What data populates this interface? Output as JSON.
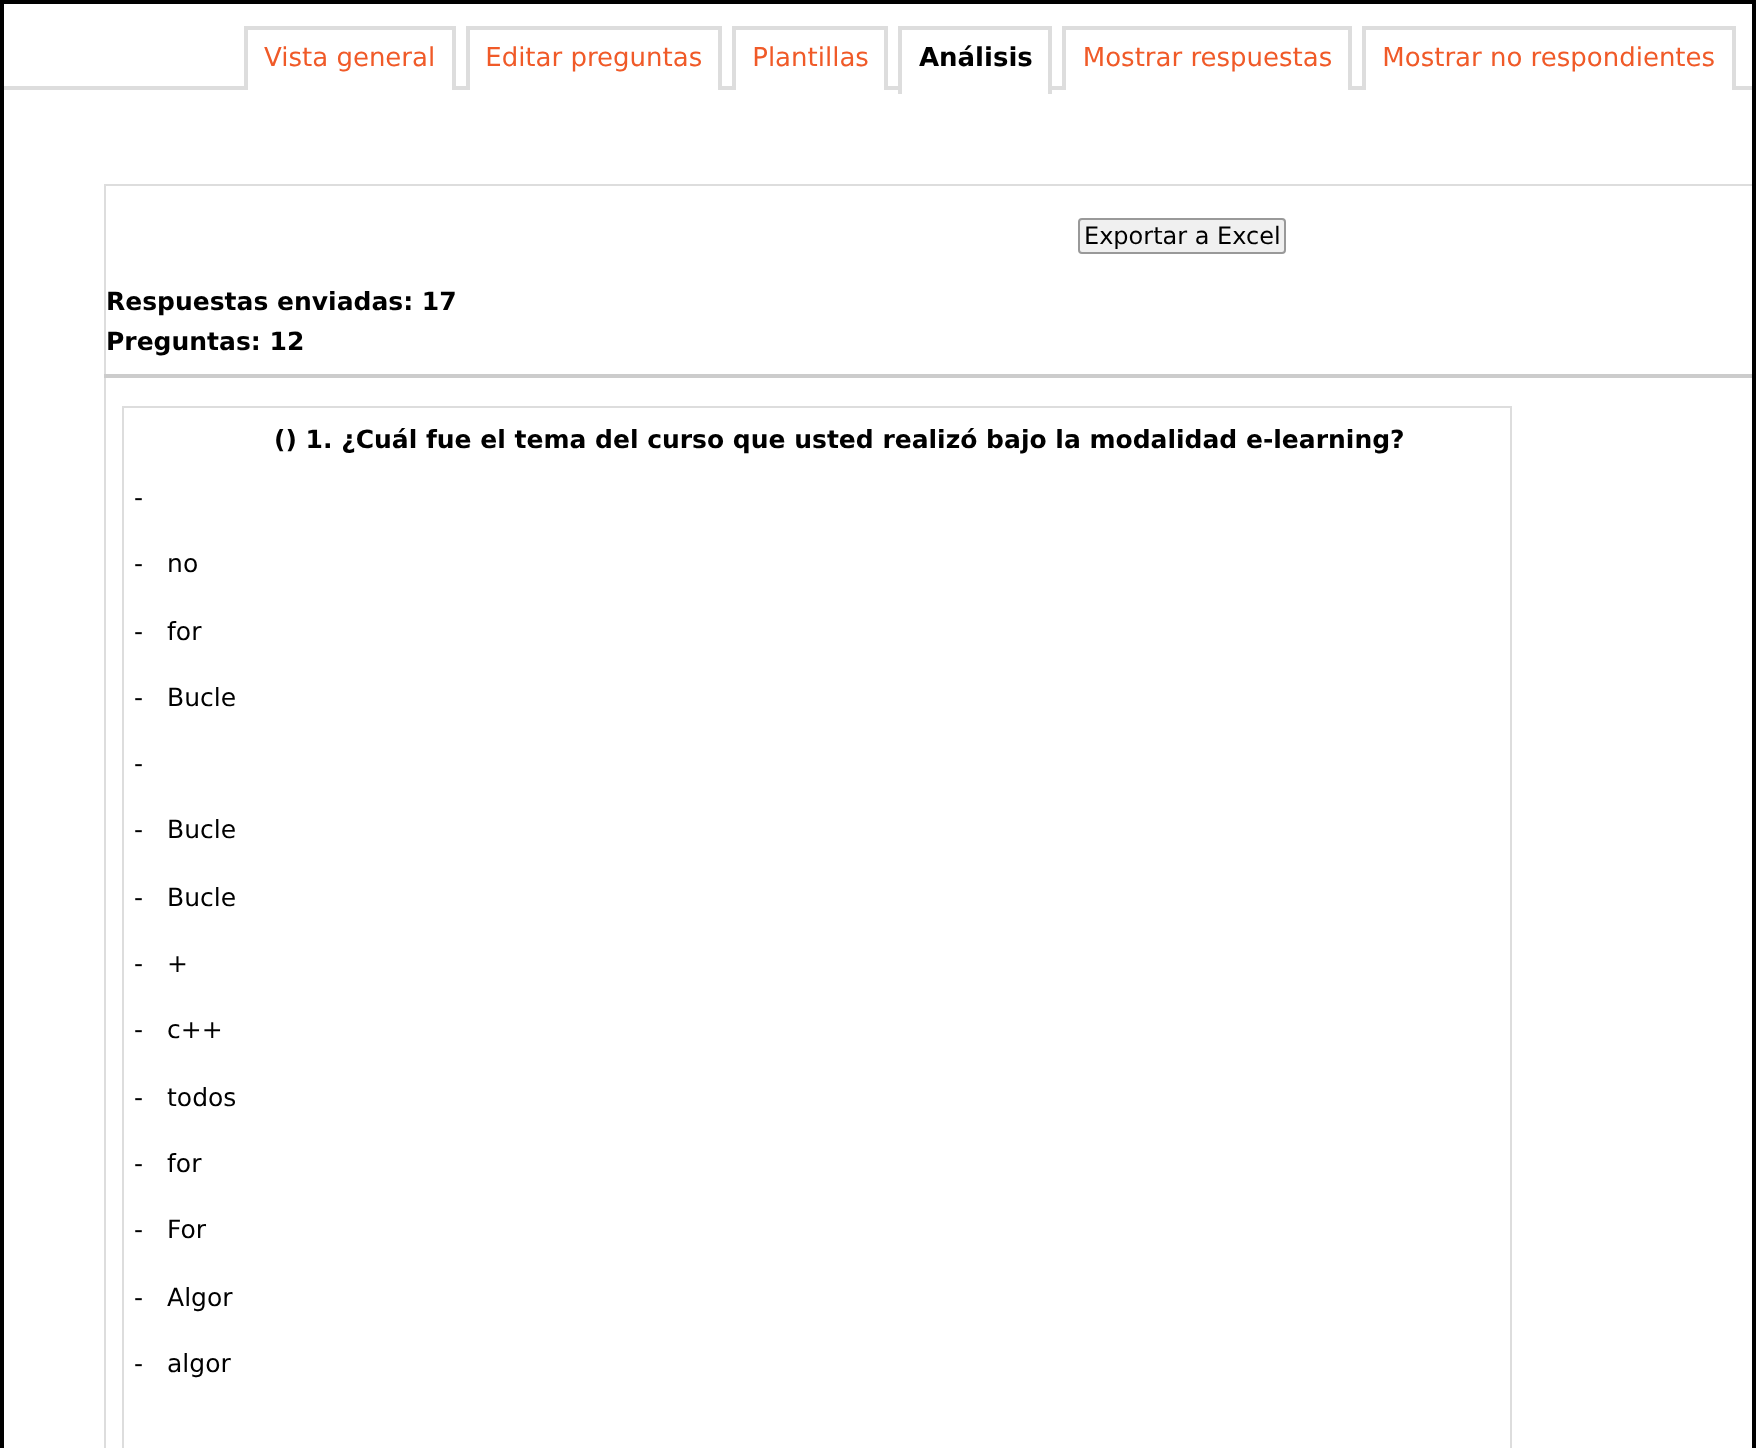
{
  "tabs": [
    {
      "label": "Vista general",
      "selected": false
    },
    {
      "label": "Editar preguntas",
      "selected": false
    },
    {
      "label": "Plantillas",
      "selected": false
    },
    {
      "label": "Análisis",
      "selected": true
    },
    {
      "label": "Mostrar respuestas",
      "selected": false
    },
    {
      "label": "Mostrar no respondientes",
      "selected": false
    }
  ],
  "export_button": "Exportar a Excel",
  "stats": [
    "Respuestas enviadas: 17",
    "Preguntas: 12"
  ],
  "question": {
    "title": "() 1. ¿Cuál fue el tema del curso que usted realizó bajo la modalidad e-learning?",
    "answers": [
      {
        "dash": "-"
      },
      {
        "dash": "-",
        "text": "no"
      },
      {
        "dash": "-",
        "text": "for"
      },
      {
        "dash": "-",
        "text": "Bucle"
      },
      {
        "dash": "-"
      },
      {
        "dash": "-",
        "text": "Bucle"
      },
      {
        "dash": "-",
        "text": "Bucle"
      },
      {
        "dash": "-",
        "text": "+"
      },
      {
        "dash": "-",
        "text": "c++"
      },
      {
        "dash": "-",
        "text": "todos"
      },
      {
        "dash": "-",
        "text": "for"
      },
      {
        "dash": "-",
        "text": "For"
      },
      {
        "dash": "-",
        "text": "Algor"
      },
      {
        "dash": "-",
        "text": "algor"
      }
    ]
  }
}
